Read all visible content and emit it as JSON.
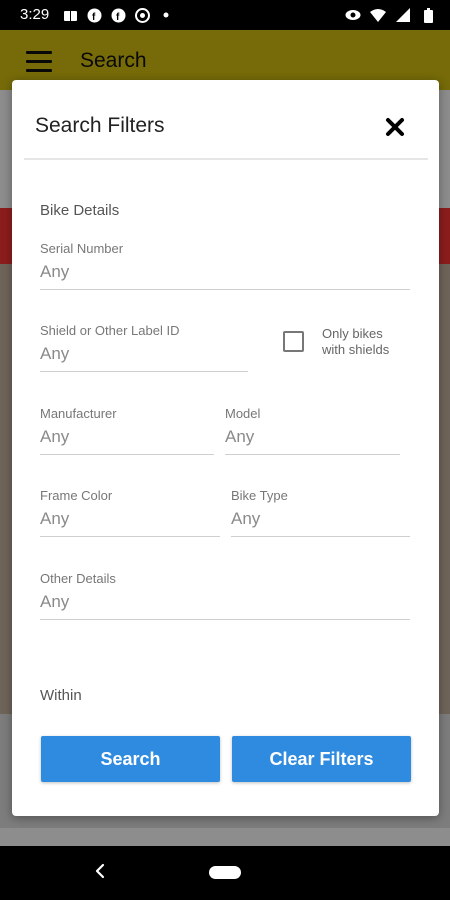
{
  "status_bar": {
    "time": "3:29",
    "left_icons": [
      "book-icon",
      "facebook-icon",
      "facebook-icon",
      "settings-icon",
      "dot-icon"
    ],
    "right_icons": [
      "eye-icon",
      "wifi-icon",
      "signal-icon",
      "battery-icon"
    ]
  },
  "app_bar": {
    "title": "Search"
  },
  "dialog": {
    "title": "Search Filters",
    "section_bike_details": "Bike Details",
    "serial_number": {
      "label": "Serial Number",
      "placeholder": "Any"
    },
    "shield_id": {
      "label": "Shield or Other Label ID",
      "placeholder": "Any"
    },
    "only_shields": {
      "label_line1": "Only bikes",
      "label_line2": "with shields",
      "checked": false
    },
    "manufacturer": {
      "label": "Manufacturer",
      "placeholder": "Any"
    },
    "model": {
      "label": "Model",
      "placeholder": "Any"
    },
    "frame_color": {
      "label": "Frame Color",
      "placeholder": "Any"
    },
    "bike_type": {
      "label": "Bike Type",
      "placeholder": "Any"
    },
    "other_details": {
      "label": "Other Details",
      "placeholder": "Any"
    },
    "section_within": "Within",
    "search_button": "Search",
    "clear_button": "Clear Filters",
    "accent_color": "#2f8be0"
  }
}
